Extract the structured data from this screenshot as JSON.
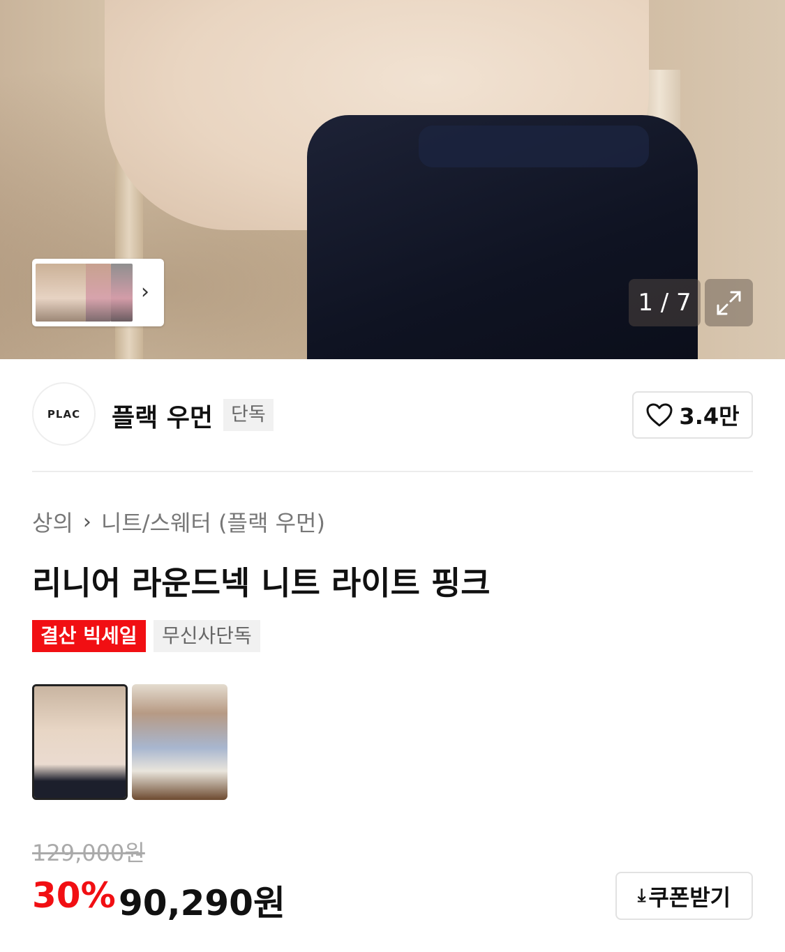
{
  "gallery": {
    "counter": "1 / 7",
    "icons": {
      "next": "chevron-right-icon",
      "expand": "expand-icon"
    }
  },
  "brand": {
    "logo_text": "PLAC",
    "name": "플랙 우먼",
    "badge": "단독",
    "like_count": "3.4만"
  },
  "breadcrumb": {
    "category": "상의",
    "subcategory": "니트/스웨터 (플랙 우먼)"
  },
  "product": {
    "title": "리니어 라운드넥 니트 라이트 핑크",
    "tags": [
      "결산 빅세일",
      "무신사단독"
    ]
  },
  "price": {
    "original": "129,000원",
    "discount": "30%",
    "sale": "90,290원",
    "coupon_label": "쿠폰받기"
  },
  "colors": {
    "accent": "#f10f13"
  }
}
